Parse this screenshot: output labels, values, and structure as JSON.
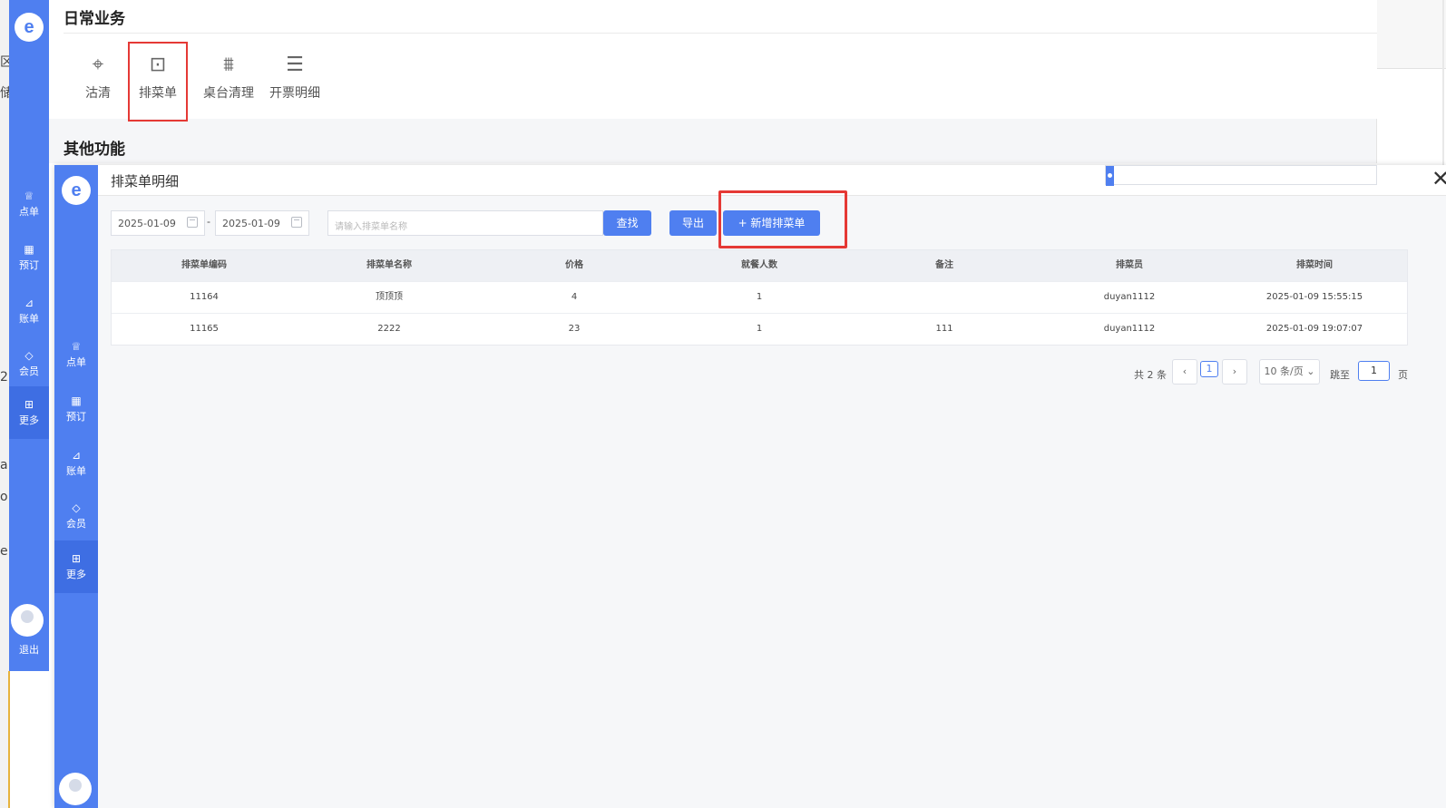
{
  "background": {
    "left_chars": [
      "区",
      "储",
      "a",
      "o",
      "2",
      "e"
    ],
    "sidebar": {
      "logo": "e",
      "items": [
        {
          "icon": "chef-hat-icon",
          "glyph": "♕",
          "label": "点单"
        },
        {
          "icon": "booking-icon",
          "glyph": "▦",
          "label": "预订"
        },
        {
          "icon": "chart-icon",
          "glyph": "⊿",
          "label": "账单"
        },
        {
          "icon": "diamond-icon",
          "glyph": "◇",
          "label": "会员"
        },
        {
          "icon": "grid-icon",
          "glyph": "⊞",
          "label": "更多"
        }
      ],
      "logout_label": "退出"
    },
    "daily_title": "日常业务",
    "daily_items": [
      {
        "icon": "tag-icon",
        "glyph": "⌖",
        "label": "沽清"
      },
      {
        "icon": "menu-box-icon",
        "glyph": "⊡",
        "label": "排菜单"
      },
      {
        "icon": "broom-icon",
        "glyph": "⩩",
        "label": "桌台清理"
      },
      {
        "icon": "receipt-icon",
        "glyph": "☰",
        "label": "开票明细"
      }
    ],
    "other_title": "其他功能"
  },
  "modal": {
    "title": "排菜单明细",
    "close_glyph": "✕",
    "filters": {
      "start_date": "2025-01-09",
      "end_date": "2025-01-09",
      "separator": "-",
      "search_placeholder": "请输入排菜单名称",
      "search_button": "查找",
      "export_button": "导出",
      "add_button": "+  新增排菜单"
    },
    "table": {
      "headers": [
        "排菜单编码",
        "排菜单名称",
        "价格",
        "就餐人数",
        "备注",
        "排菜员",
        "排菜时间"
      ],
      "rows": [
        [
          "11164",
          "顶顶顶",
          "4",
          "1",
          "",
          "duyan1112",
          "2025-01-09 15:55:15"
        ],
        [
          "11165",
          "2222",
          "23",
          "1",
          "111",
          "duyan1112",
          "2025-01-09 19:07:07"
        ]
      ]
    },
    "pagination": {
      "total": "共 2 条",
      "prev": "‹",
      "current_page": "1",
      "next": "›",
      "page_size": "10 条/页 ⌄",
      "jump_label": "跳至",
      "jump_value": "1",
      "page_suffix": "页"
    }
  }
}
